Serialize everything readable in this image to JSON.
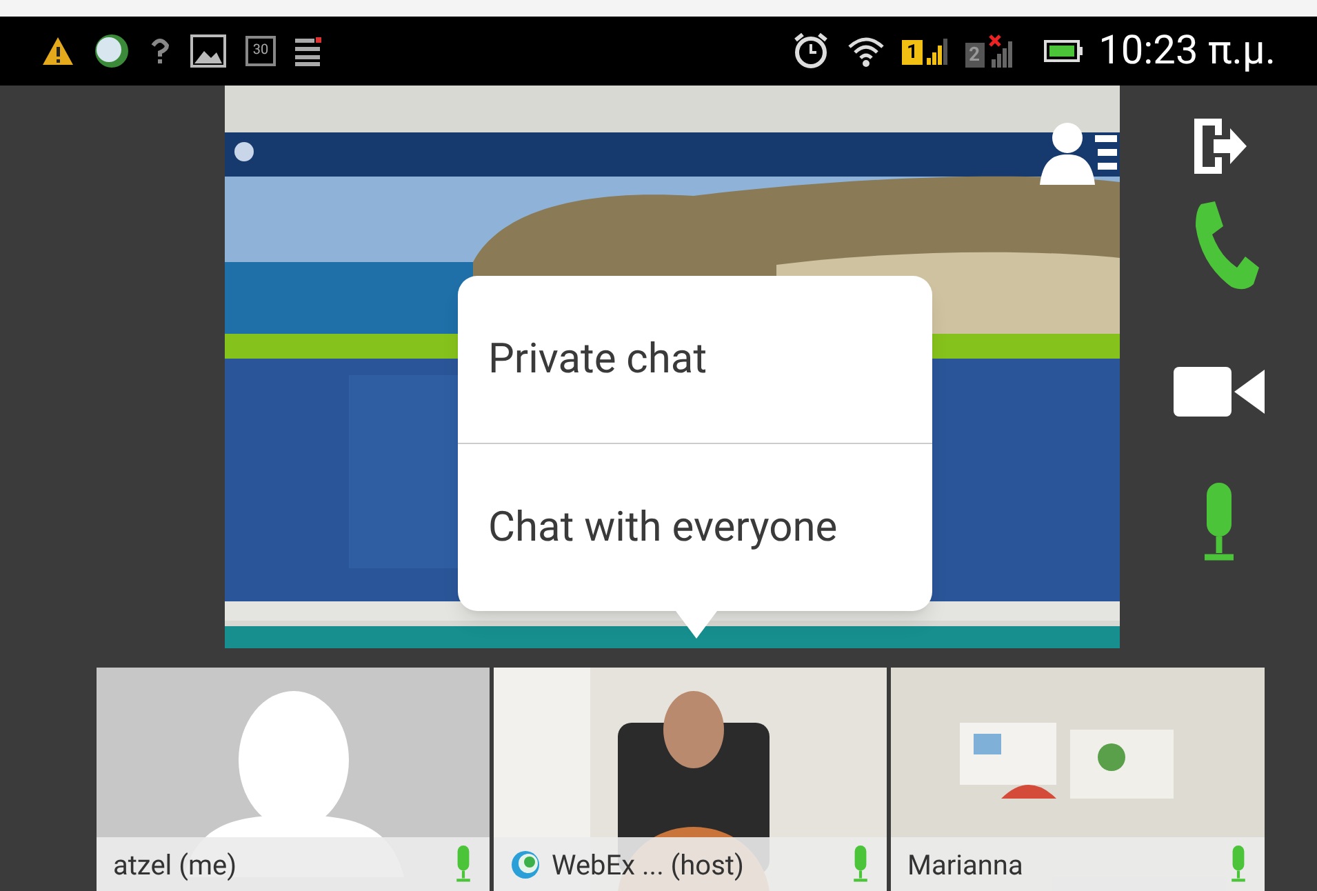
{
  "status_bar": {
    "calendar_day": "30",
    "sim1": "1",
    "sim2": "2",
    "time": "10:23 π.μ."
  },
  "menu": {
    "items": [
      {
        "label": "Private chat"
      },
      {
        "label": "Chat with everyone"
      }
    ]
  },
  "participants": [
    {
      "name": "atzel (me)",
      "kind": "avatar",
      "host": false,
      "mic_on": true
    },
    {
      "name": "WebEx ... (host)",
      "kind": "video",
      "host": true,
      "mic_on": true
    },
    {
      "name": "Marianna",
      "kind": "room",
      "host": false,
      "mic_on": true
    }
  ]
}
